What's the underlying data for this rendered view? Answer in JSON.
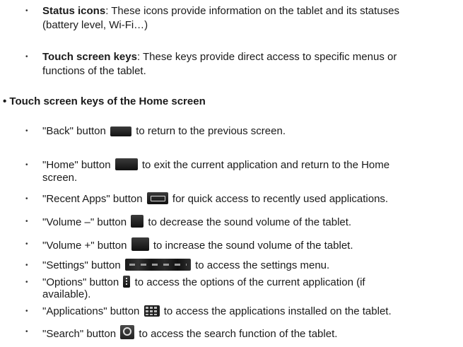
{
  "intro": [
    {
      "term": "Status icons",
      "text": ": These icons provide information on the tablet and its statuses",
      "text2": "(battery level, Wi-Fi…)"
    },
    {
      "term": "Touch screen keys",
      "text": ": These keys provide direct access to specific menus or",
      "text2": "functions of the tablet."
    }
  ],
  "section_title": "• Touch screen keys of the Home screen",
  "keys": [
    {
      "label": "\"Back\" button",
      "icon": "back-icon",
      "desc": "to return to the previous screen."
    },
    {
      "label": "\"Home\" button",
      "icon": "home-icon",
      "desc": "to exit the current application and return to the Home",
      "desc2": "screen."
    },
    {
      "label": "\"Recent Apps\" button",
      "icon": "recent-apps-icon",
      "desc": "for quick access to recently used applications."
    },
    {
      "label": "\"Volume –\" button",
      "icon": "volume-down-icon",
      "desc": "to decrease the sound volume of the tablet."
    },
    {
      "label": "\"Volume +\" button",
      "icon": "volume-up-icon",
      "desc": "to increase the sound volume of the tablet."
    },
    {
      "label": "\"Settings\" button",
      "icon": "settings-icon",
      "desc": "to access the settings menu."
    },
    {
      "label": "\"Options\" button",
      "icon": "options-icon",
      "desc": "to access the options of the current application (if",
      "desc2": "available)."
    },
    {
      "label": "\"Applications\" button",
      "icon": "applications-icon",
      "desc": "to access the applications installed on the tablet."
    },
    {
      "label": "\"Search\" button",
      "icon": "search-icon",
      "desc": "to access the search function of the tablet."
    }
  ],
  "bullet": "•"
}
